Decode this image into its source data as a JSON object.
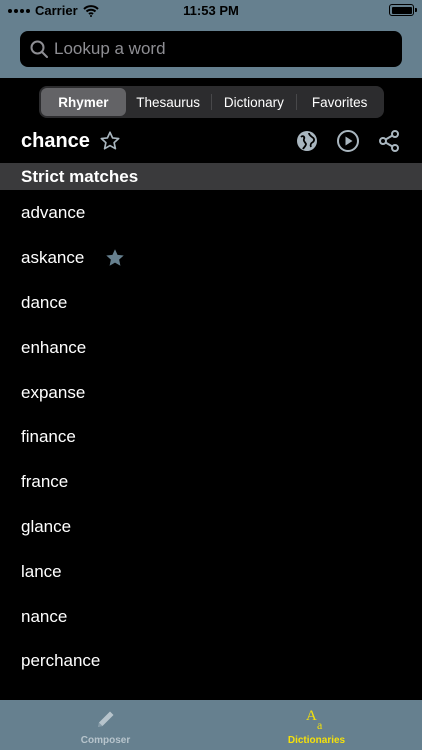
{
  "status": {
    "carrier": "Carrier",
    "time": "11:53 PM"
  },
  "search": {
    "placeholder": "Lookup a word",
    "value": ""
  },
  "segments": [
    {
      "label": "Rhymer",
      "active": true
    },
    {
      "label": "Thesaurus",
      "active": false
    },
    {
      "label": "Dictionary",
      "active": false
    },
    {
      "label": "Favorites",
      "active": false
    }
  ],
  "word": {
    "title": "chance",
    "favorited": false
  },
  "icons": {
    "globe": "globe-icon",
    "play": "play-icon",
    "share": "share-icon",
    "star": "star-icon"
  },
  "section": {
    "title": "Strict matches"
  },
  "results": [
    {
      "word": "advance",
      "starred": false
    },
    {
      "word": "askance",
      "starred": true
    },
    {
      "word": "dance",
      "starred": false
    },
    {
      "word": "enhance",
      "starred": false
    },
    {
      "word": "expanse",
      "starred": false
    },
    {
      "word": "finance",
      "starred": false
    },
    {
      "word": "france",
      "starred": false
    },
    {
      "word": "glance",
      "starred": false
    },
    {
      "word": "lance",
      "starred": false
    },
    {
      "word": "nance",
      "starred": false
    },
    {
      "word": "perchance",
      "starred": false
    }
  ],
  "tabs": [
    {
      "label": "Composer",
      "icon": "pencil-icon",
      "active": false
    },
    {
      "label": "Dictionaries",
      "icon": "dictionary-icon",
      "active": true
    }
  ],
  "colors": {
    "header_bg": "#66808f",
    "active_tab": "#f5e10a",
    "inactive_tab": "#b7c4cc",
    "icon_muted": "#a9b6bf",
    "starred": "#66808f"
  }
}
